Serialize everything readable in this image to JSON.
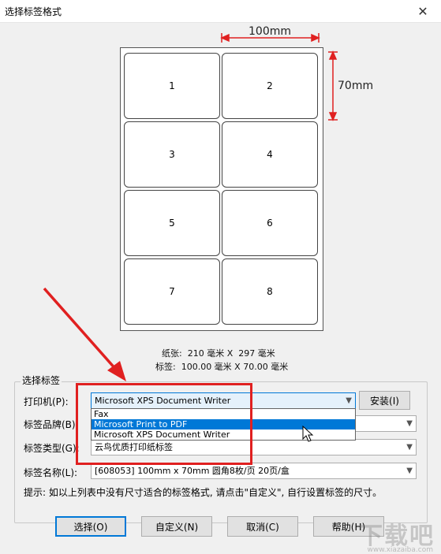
{
  "window": {
    "title": "选择标签格式",
    "close_glyph": "✕"
  },
  "preview": {
    "width_label": "100mm",
    "height_label": "70mm",
    "cells": [
      "1",
      "2",
      "3",
      "4",
      "5",
      "6",
      "7",
      "8"
    ],
    "paper_line": "纸张:  210 毫米 X  297 毫米",
    "label_line": "标签:  100.00 毫米 X 70.00 毫米",
    "dimension_color": "#e02020"
  },
  "group": {
    "legend": "选择标签",
    "printer_label": "打印机(P):",
    "printer_value": "Microsoft XPS Document Writer",
    "install_button": "安装(I)",
    "brand_label": "标签品牌(B):",
    "type_label": "标签类型(G):",
    "type_value": "云鸟优质打印纸标签",
    "name_label": "标签名称(L):",
    "name_value": "[608053] 100mm x 70mm 圆角8枚/页 20页/盒",
    "dropdown_options": [
      "Fax",
      "Microsoft Print to PDF",
      "Microsoft XPS Document Writer"
    ],
    "dropdown_selected_index": 1,
    "hint": "提示: 如以上列表中没有尺寸适合的标签格式, 请点击\"自定义\", 自行设置标签的尺寸。"
  },
  "buttons": {
    "select": "选择(O)",
    "custom": "自定义(N)",
    "cancel": "取消(C)",
    "help": "帮助(H)"
  },
  "annotation": {
    "arrow_color": "#e02020"
  },
  "watermark": {
    "main": "下载吧",
    "sub": "www.xiazaiba.com"
  }
}
